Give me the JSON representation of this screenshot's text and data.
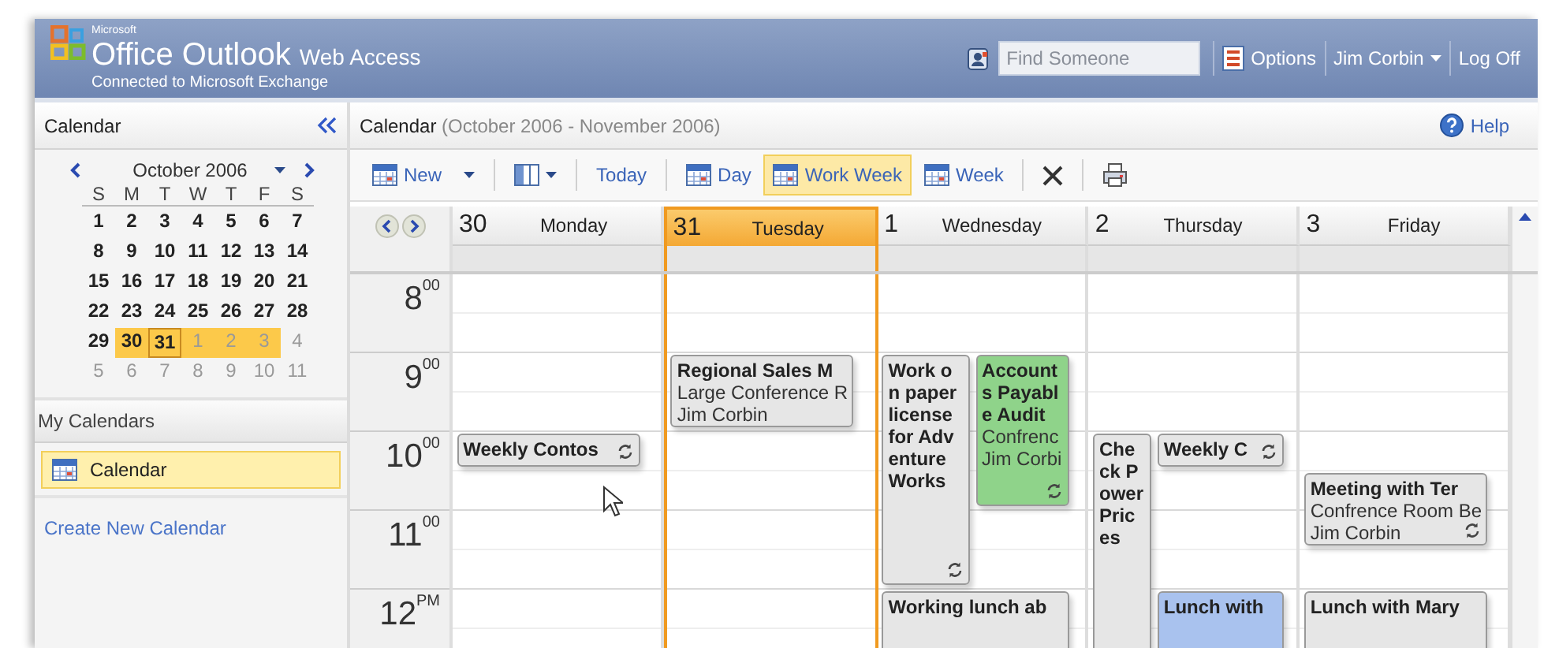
{
  "banner": {
    "brand_small": "Microsoft",
    "product": "Office Outlook",
    "product_suffix": "Web Access",
    "subtitle": "Connected to Microsoft Exchange",
    "search": {
      "placeholder": "Find Someone"
    },
    "links": [
      {
        "kind": "options",
        "label": "Options"
      },
      {
        "kind": "user",
        "label": "Jim Corbin"
      },
      {
        "kind": "plain",
        "label": "Log Off"
      }
    ]
  },
  "sidebar": {
    "title": "Calendar",
    "mini_calendar": {
      "month": "October 2006",
      "weekdays": [
        "S",
        "M",
        "T",
        "W",
        "T",
        "F",
        "S"
      ],
      "days": [
        {
          "day": "1",
          "other_month": false,
          "selected": false,
          "today": false
        },
        {
          "day": "2",
          "other_month": false,
          "selected": false,
          "today": false
        },
        {
          "day": "3",
          "other_month": false,
          "selected": false,
          "today": false
        },
        {
          "day": "4",
          "other_month": false,
          "selected": false,
          "today": false
        },
        {
          "day": "5",
          "other_month": false,
          "selected": false,
          "today": false
        },
        {
          "day": "6",
          "other_month": false,
          "selected": false,
          "today": false
        },
        {
          "day": "7",
          "other_month": false,
          "selected": false,
          "today": false
        },
        {
          "day": "8",
          "other_month": false,
          "selected": false,
          "today": false
        },
        {
          "day": "9",
          "other_month": false,
          "selected": false,
          "today": false
        },
        {
          "day": "10",
          "other_month": false,
          "selected": false,
          "today": false
        },
        {
          "day": "11",
          "other_month": false,
          "selected": false,
          "today": false
        },
        {
          "day": "12",
          "other_month": false,
          "selected": false,
          "today": false
        },
        {
          "day": "13",
          "other_month": false,
          "selected": false,
          "today": false
        },
        {
          "day": "14",
          "other_month": false,
          "selected": false,
          "today": false
        },
        {
          "day": "15",
          "other_month": false,
          "selected": false,
          "today": false
        },
        {
          "day": "16",
          "other_month": false,
          "selected": false,
          "today": false
        },
        {
          "day": "17",
          "other_month": false,
          "selected": false,
          "today": false
        },
        {
          "day": "18",
          "other_month": false,
          "selected": false,
          "today": false
        },
        {
          "day": "19",
          "other_month": false,
          "selected": false,
          "today": false
        },
        {
          "day": "20",
          "other_month": false,
          "selected": false,
          "today": false
        },
        {
          "day": "21",
          "other_month": false,
          "selected": false,
          "today": false
        },
        {
          "day": "22",
          "other_month": false,
          "selected": false,
          "today": false
        },
        {
          "day": "23",
          "other_month": false,
          "selected": false,
          "today": false
        },
        {
          "day": "24",
          "other_month": false,
          "selected": false,
          "today": false
        },
        {
          "day": "25",
          "other_month": false,
          "selected": false,
          "today": false
        },
        {
          "day": "26",
          "other_month": false,
          "selected": false,
          "today": false
        },
        {
          "day": "27",
          "other_month": false,
          "selected": false,
          "today": false
        },
        {
          "day": "28",
          "other_month": false,
          "selected": false,
          "today": false
        },
        {
          "day": "29",
          "other_month": false,
          "selected": false,
          "today": false
        },
        {
          "day": "30",
          "other_month": false,
          "selected": true,
          "today": false
        },
        {
          "day": "31",
          "other_month": false,
          "selected": true,
          "today": true
        },
        {
          "day": "1",
          "other_month": true,
          "selected": true,
          "today": false
        },
        {
          "day": "2",
          "other_month": true,
          "selected": true,
          "today": false
        },
        {
          "day": "3",
          "other_month": true,
          "selected": true,
          "today": false
        },
        {
          "day": "4",
          "other_month": true,
          "selected": false,
          "today": false
        },
        {
          "day": "5",
          "other_month": true,
          "selected": false,
          "today": false
        },
        {
          "day": "6",
          "other_month": true,
          "selected": false,
          "today": false
        },
        {
          "day": "7",
          "other_month": true,
          "selected": false,
          "today": false
        },
        {
          "day": "8",
          "other_month": true,
          "selected": false,
          "today": false
        },
        {
          "day": "9",
          "other_month": true,
          "selected": false,
          "today": false
        },
        {
          "day": "10",
          "other_month": true,
          "selected": false,
          "today": false
        },
        {
          "day": "11",
          "other_month": true,
          "selected": false,
          "today": false
        }
      ]
    },
    "section": "My Calendars",
    "calendars": [
      {
        "label": "Calendar",
        "selected": true
      }
    ],
    "create_link": "Create New Calendar"
  },
  "main": {
    "title": "Calendar",
    "range": "(October 2006 - November 2006)",
    "help": "Help",
    "toolbar": [
      {
        "kind": "new",
        "label": "New"
      },
      {
        "kind": "layout"
      },
      {
        "kind": "text",
        "label": "Today"
      },
      {
        "kind": "view",
        "label": "Day",
        "selected": false
      },
      {
        "kind": "view",
        "label": "Work Week",
        "selected": true
      },
      {
        "kind": "view",
        "label": "Week",
        "selected": false
      },
      {
        "kind": "delete"
      },
      {
        "kind": "print"
      }
    ],
    "hours": [
      "8$^{00}$",
      "9$^{00}$",
      "10$^{00}$",
      "11$^{00}$",
      "12$^{PM}$"
    ],
    "days": [
      {
        "date": "30",
        "name": "Monday",
        "selected": false,
        "events": [
          {
            "title": "Weekly Contos",
            "recurring": true,
            "color": "#e6e6e6"
          }
        ]
      },
      {
        "date": "31",
        "name": "Tuesday",
        "selected": true,
        "events": [
          {
            "title": "Regional Sales M",
            "location": "Large Conference R",
            "organizer": "Jim Corbin",
            "recurring": false,
            "color": "#e6e6e6"
          }
        ]
      },
      {
        "date": "1",
        "name": "Wednesday",
        "selected": false,
        "events": [
          {
            "title": "Work on paper license for Adventure Works",
            "recurring": true,
            "color": "#e6e6e6"
          },
          {
            "title": "Accounts Payable Audit",
            "location": "Confrenc",
            "organizer": "Jim Corbi",
            "recurring": true,
            "color": "#8fd38a"
          },
          {
            "title": "Working lunch ab",
            "recurring": false,
            "color": "#e6e6e6"
          }
        ]
      },
      {
        "date": "2",
        "name": "Thursday",
        "selected": false,
        "events": [
          {
            "title": "Check Power Prices",
            "recurring": false,
            "color": "#e6e6e6"
          },
          {
            "title": "Weekly C",
            "recurring": true,
            "color": "#e6e6e6"
          },
          {
            "title": "Lunch with",
            "recurring": false,
            "color": "#a9c2ee"
          }
        ]
      },
      {
        "date": "3",
        "name": "Friday",
        "selected": false,
        "events": [
          {
            "title": "Meeting with Ter",
            "location": "Confrence Room Be",
            "organizer": "Jim Corbin",
            "recurring": true,
            "color": "#e6e6e6"
          },
          {
            "title": "Lunch with Mary",
            "recurring": false,
            "color": "#e6e6e6"
          }
        ]
      }
    ]
  }
}
